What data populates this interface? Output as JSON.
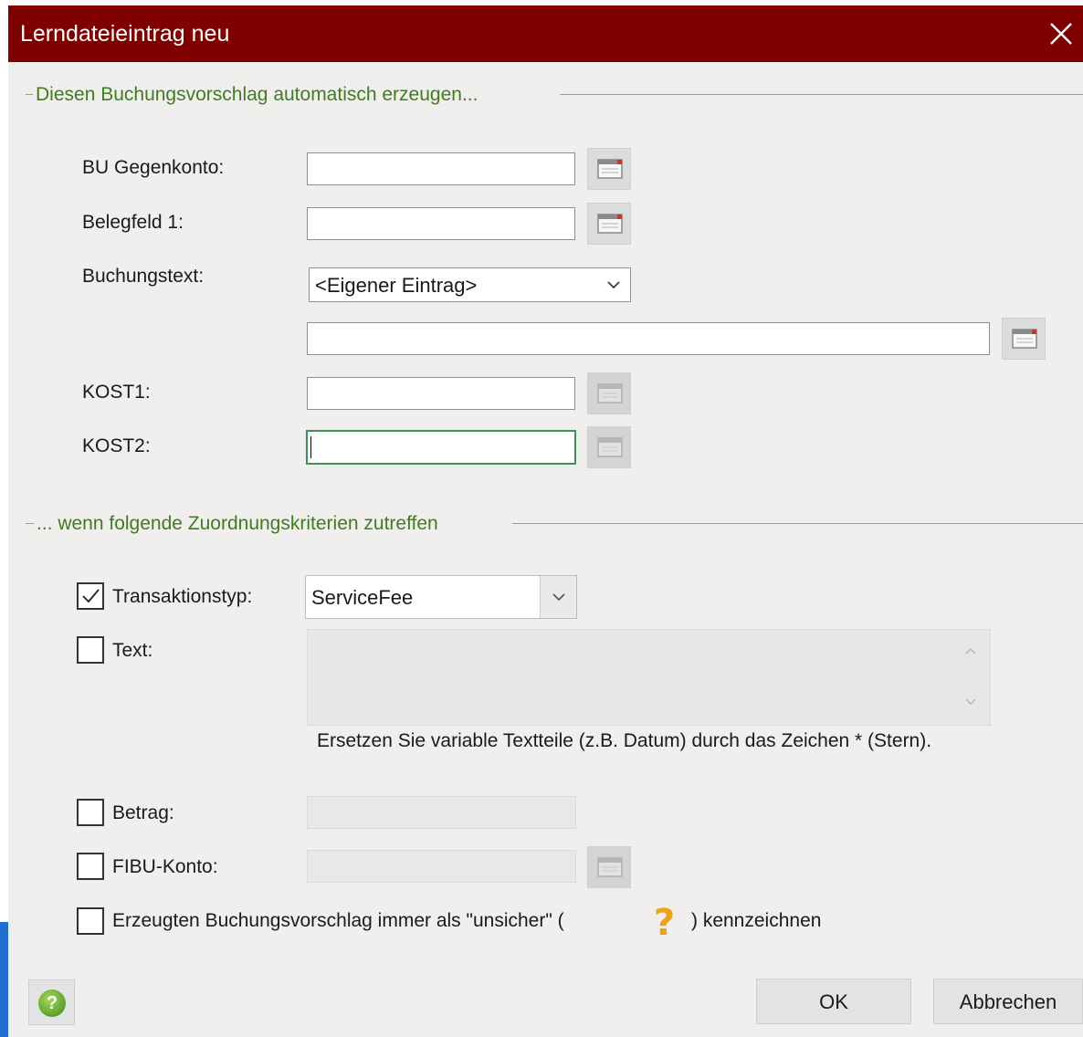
{
  "window": {
    "title": "Lerndateieintrag neu"
  },
  "section1": {
    "title": "Diesen Buchungsvorschlag automatisch erzeugen..."
  },
  "fields": {
    "bu_gegenkonto": {
      "label": "BU Gegenkonto:",
      "value": ""
    },
    "belegfeld1": {
      "label": "Belegfeld 1:",
      "value": ""
    },
    "buchungstext": {
      "label": "Buchungstext:",
      "selected": "<Eigener Eintrag>",
      "value": ""
    },
    "kost1": {
      "label": "KOST1:",
      "value": ""
    },
    "kost2": {
      "label": "KOST2:",
      "value": ""
    }
  },
  "section2": {
    "title": "... wenn folgende Zuordnungskriterien zutreffen"
  },
  "criteria": {
    "transaktionstyp": {
      "label": "Transaktionstyp:",
      "checked": true,
      "selected": "ServiceFee"
    },
    "text": {
      "label": "Text:",
      "checked": false,
      "value": "",
      "hint": "Ersetzen Sie variable Textteile (z.B. Datum) durch das Zeichen * (Stern)."
    },
    "betrag": {
      "label": "Betrag:",
      "checked": false,
      "value": ""
    },
    "fibu_konto": {
      "label": "FIBU-Konto:",
      "checked": false,
      "value": ""
    },
    "unsicher": {
      "label_before": "Erzeugten Buchungsvorschlag immer als \"unsicher\" (",
      "icon": "question-mark-icon",
      "label_after": ") kennzeichnen",
      "checked": false
    }
  },
  "buttons": {
    "help": "?",
    "ok": "OK",
    "cancel": "Abbrechen"
  },
  "colors": {
    "titlebar": "#800000",
    "section_title": "#3f7d1f",
    "question_icon": "#f2a10f"
  }
}
